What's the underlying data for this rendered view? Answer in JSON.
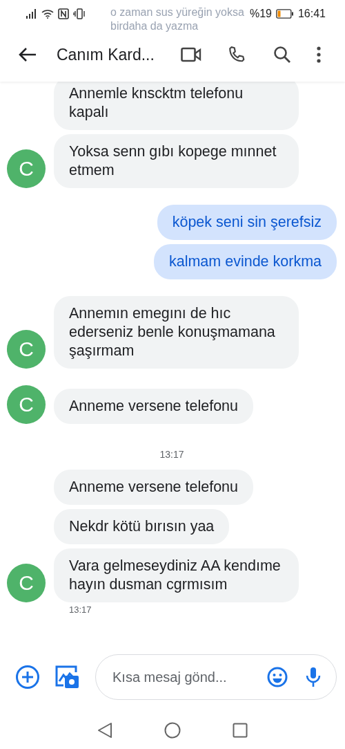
{
  "status_bar": {
    "battery_text": "%19",
    "time": "16:41"
  },
  "notification": {
    "text": "o zaman sus yüreğin yoksa birdaha da yazma"
  },
  "header": {
    "title": "Canım Kard..."
  },
  "messages": [
    {
      "kind": "incoming",
      "text": "Annemle knscktm telefonu kapalı"
    },
    {
      "kind": "incoming",
      "text": "Yoksa senn gıbı kopege mınnet etmem",
      "avatar": "C"
    },
    {
      "kind": "outgoing",
      "text": "köpek seni sin şerefsiz"
    },
    {
      "kind": "outgoing",
      "text": "kalmam evinde korkma"
    },
    {
      "kind": "incoming",
      "text": "Annemın emegını de hıc ederseniz benle konuşmamana şaşırmam",
      "avatar": "C"
    },
    {
      "kind": "incoming",
      "text": "Anneme versene telefonu",
      "avatar": "C"
    },
    {
      "kind": "separator",
      "text": "13:17"
    },
    {
      "kind": "incoming",
      "text": "Anneme versene telefonu"
    },
    {
      "kind": "incoming",
      "text": "Nekdr kötü bırısın yaa"
    },
    {
      "kind": "incoming",
      "text": "Vara gelmeseydiniz AA kendıme hayın dusman cgrmısım",
      "avatar": "C",
      "time": "13:17"
    }
  ],
  "composer": {
    "placeholder": "Kısa mesaj gönd..."
  }
}
